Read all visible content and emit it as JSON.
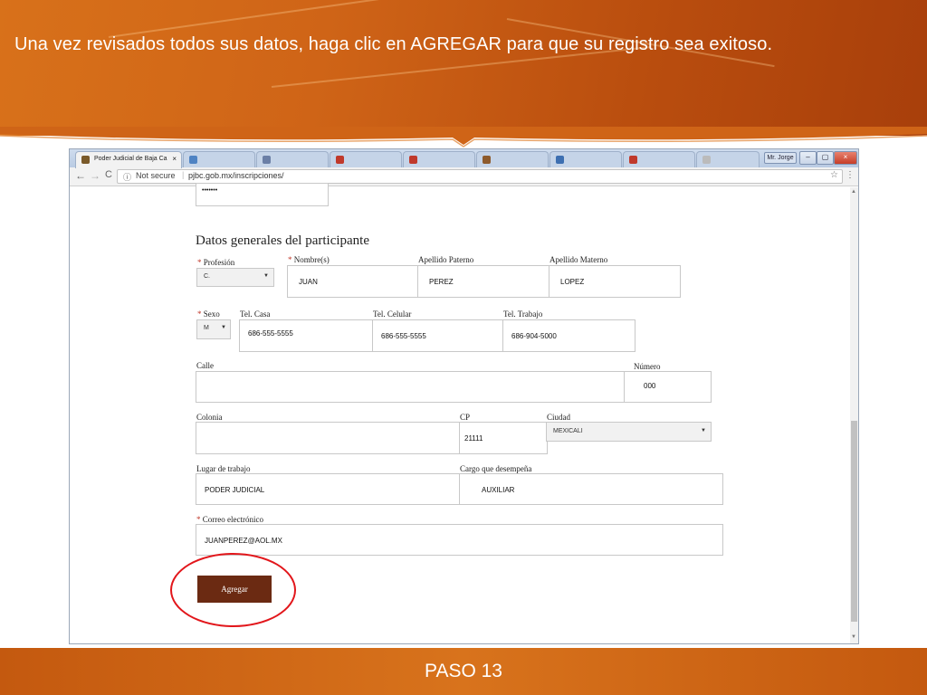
{
  "slide": {
    "title": "Una vez revisados todos sus datos, haga clic en AGREGAR para que su registro sea exitoso.",
    "footer": "PASO 13"
  },
  "browser": {
    "active_tab": "Poder Judicial de Baja Ca",
    "tab_close": "×",
    "url_security": "Not secure",
    "url": "pjbc.gob.mx/inscripciones/",
    "window_controls": {
      "user": "Mr. Jorge",
      "minimize": "–",
      "maximize": "▢",
      "close": "×"
    },
    "nav": {
      "back": "←",
      "forward": "→",
      "reload": "C"
    }
  },
  "form": {
    "password_mask": "•••••••",
    "section_title": "Datos generales del participante",
    "required_mark": "*",
    "profesion": {
      "label": "Profesión",
      "value": "C."
    },
    "nombre": {
      "label": "Nombre(s)",
      "value": "JUAN"
    },
    "apellido_paterno": {
      "label": "Apellido Paterno",
      "value": "PEREZ"
    },
    "apellido_materno": {
      "label": "Apellido Materno",
      "value": "LOPEZ"
    },
    "sexo": {
      "label": "Sexo",
      "value": "M"
    },
    "tel_casa": {
      "label": "Tel. Casa",
      "value": "686-555-5555"
    },
    "tel_celular": {
      "label": "Tel. Celular",
      "value": "686-555-5555"
    },
    "tel_trabajo": {
      "label": "Tel. Trabajo",
      "value": "686-904-5000"
    },
    "calle": {
      "label": "Calle",
      "value": ""
    },
    "numero": {
      "label": "Número",
      "value": "000"
    },
    "colonia": {
      "label": "Colonia",
      "value": ""
    },
    "cp": {
      "label": "CP",
      "value": "21111"
    },
    "ciudad": {
      "label": "Ciudad",
      "value": "MEXICALI"
    },
    "lugar_trabajo": {
      "label": "Lugar de trabajo",
      "value": "PODER JUDICIAL"
    },
    "cargo": {
      "label": "Cargo que desempeña",
      "value": "AUXILIAR"
    },
    "correo": {
      "label": "Correo electrónico",
      "value": "JUANPEREZ@AOL.MX"
    },
    "submit_label": "Agregar"
  },
  "colors": {
    "header_orange": "#cf6417",
    "submit_brown": "#6b2a12",
    "highlight_red": "#e2161b",
    "required_red": "#c0392b"
  }
}
